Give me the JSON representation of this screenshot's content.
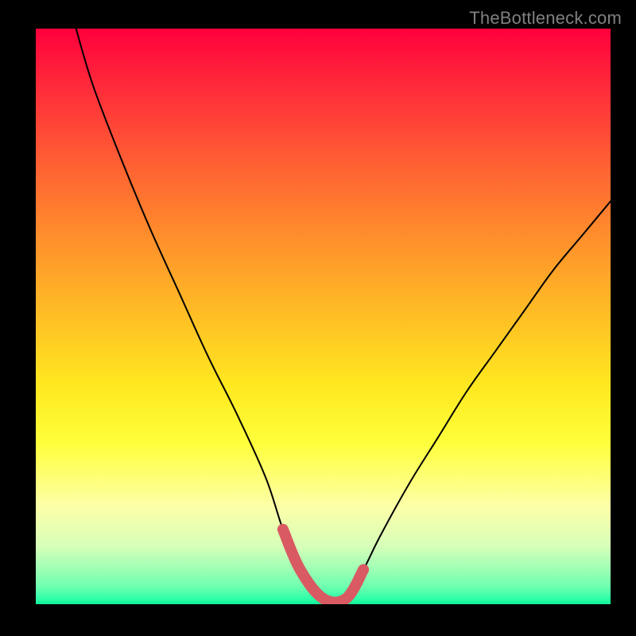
{
  "watermark": "TheBottleneck.com",
  "chart_data": {
    "type": "line",
    "title": "",
    "xlabel": "",
    "ylabel": "",
    "xlim": [
      0,
      100
    ],
    "ylim": [
      0,
      100
    ],
    "annotations": [],
    "series": [
      {
        "name": "curve",
        "color": "#000000",
        "x": [
          7,
          10,
          15,
          20,
          25,
          30,
          35,
          40,
          43,
          46,
          50,
          54,
          57,
          60,
          65,
          70,
          75,
          80,
          85,
          90,
          95,
          100
        ],
        "values": [
          100,
          90,
          77,
          65,
          54,
          43,
          33,
          22,
          13,
          6,
          1,
          1,
          6,
          12,
          21,
          29,
          37,
          44,
          51,
          58,
          64,
          70
        ]
      },
      {
        "name": "trough-marker",
        "color": "#d95a62",
        "x": [
          43,
          46,
          50,
          54,
          57
        ],
        "values": [
          13,
          6,
          1,
          1,
          6
        ]
      }
    ],
    "background_gradient": [
      "#ff003c",
      "#ffe81f",
      "#10f09a"
    ]
  }
}
